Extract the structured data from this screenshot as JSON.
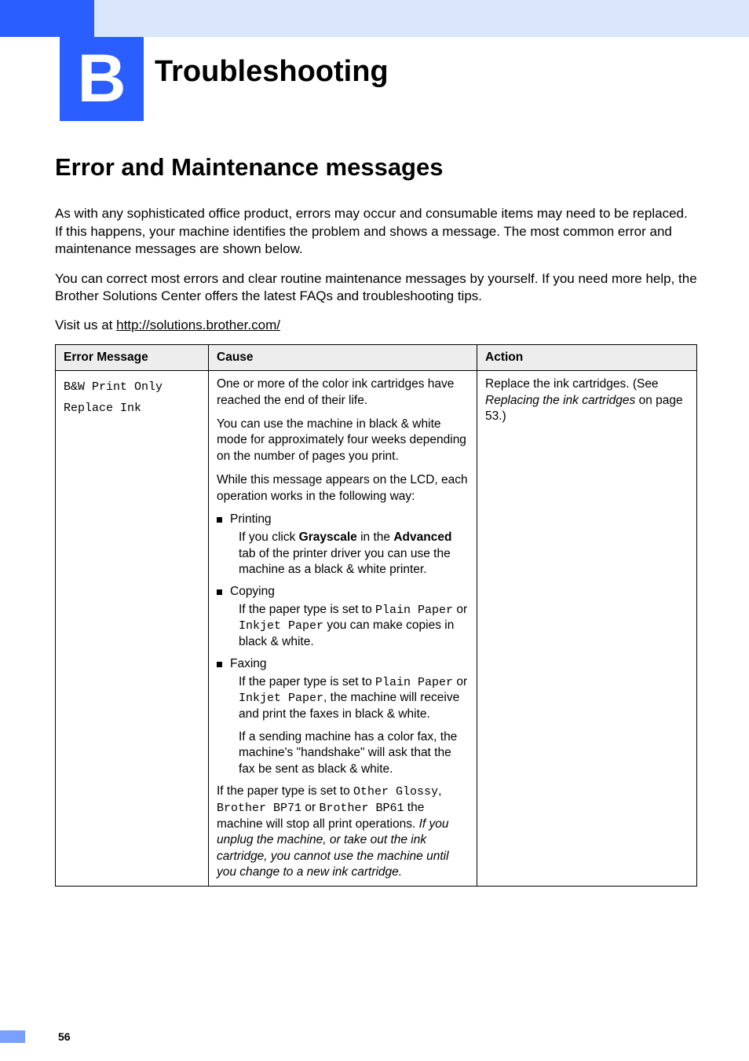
{
  "chapter": {
    "letter": "B",
    "title": "Troubleshooting"
  },
  "section_heading": "Error and Maintenance messages",
  "intro": {
    "p1": "As with any sophisticated office product, errors may occur and consumable items may need to be replaced. If this happens, your machine identifies the problem and shows a message. The most common error and maintenance messages are shown below.",
    "p2": "You can correct most errors and clear routine maintenance messages by yourself. If you need more help, the Brother Solutions Center offers the latest FAQs and troubleshooting tips.",
    "visit_prefix": "Visit us at ",
    "visit_link": "http://solutions.brother.com/"
  },
  "table": {
    "headers": {
      "error_message": "Error Message",
      "cause": "Cause",
      "action": "Action"
    },
    "row1": {
      "msg_line1": "B&W Print Only",
      "msg_line2": "Replace Ink",
      "cause": {
        "p1": "One or more of the color ink cartridges have reached the end of their life.",
        "p2": "You can use the machine in black & white mode for approximately four weeks depending on the number of pages you print.",
        "p3": "While this message appears on the LCD, each operation works in the following way:",
        "bullet1": "Printing",
        "b1_detail_pre": "If you click ",
        "b1_detail_bold1": "Grayscale",
        "b1_detail_mid": " in the ",
        "b1_detail_bold2": "Advanced",
        "b1_detail_post": " tab of the printer driver you can use the machine as a black & white printer.",
        "bullet2": "Copying",
        "b2_detail_pre": "If the paper type is set to ",
        "b2_mono1": "Plain Paper",
        "b2_detail_or": " or ",
        "b2_mono2": "Inkjet Paper",
        "b2_detail_post": " you can make copies in black & white.",
        "bullet3": "Faxing",
        "b3_detail_pre": "If the paper type is set to ",
        "b3_mono1": "Plain Paper",
        "b3_detail_or": " or ",
        "b3_mono2": "Inkjet Paper",
        "b3_detail_post": ", the machine will receive and print the faxes in black & white.",
        "b3_p2": "If a sending machine has a color fax, the machine's \"handshake\" will ask that the fax be sent as black & white.",
        "p_final_pre": "If the paper type is set to ",
        "p_final_mono1": "Other Glossy",
        "p_final_sep1": ", ",
        "p_final_mono2": "Brother BP71",
        "p_final_or": " or ",
        "p_final_mono3": "Brother BP61",
        "p_final_mid": " the machine will stop all print operations. ",
        "p_final_italic": "If you unplug the machine, or take out the ink cartridge, you cannot use the machine until you change to a new ink cartridge."
      },
      "action": {
        "pre": "Replace the ink cartridges. (See ",
        "italic": "Replacing the ink cartridges",
        "post": " on page 53.)"
      }
    }
  },
  "page_number": "56"
}
